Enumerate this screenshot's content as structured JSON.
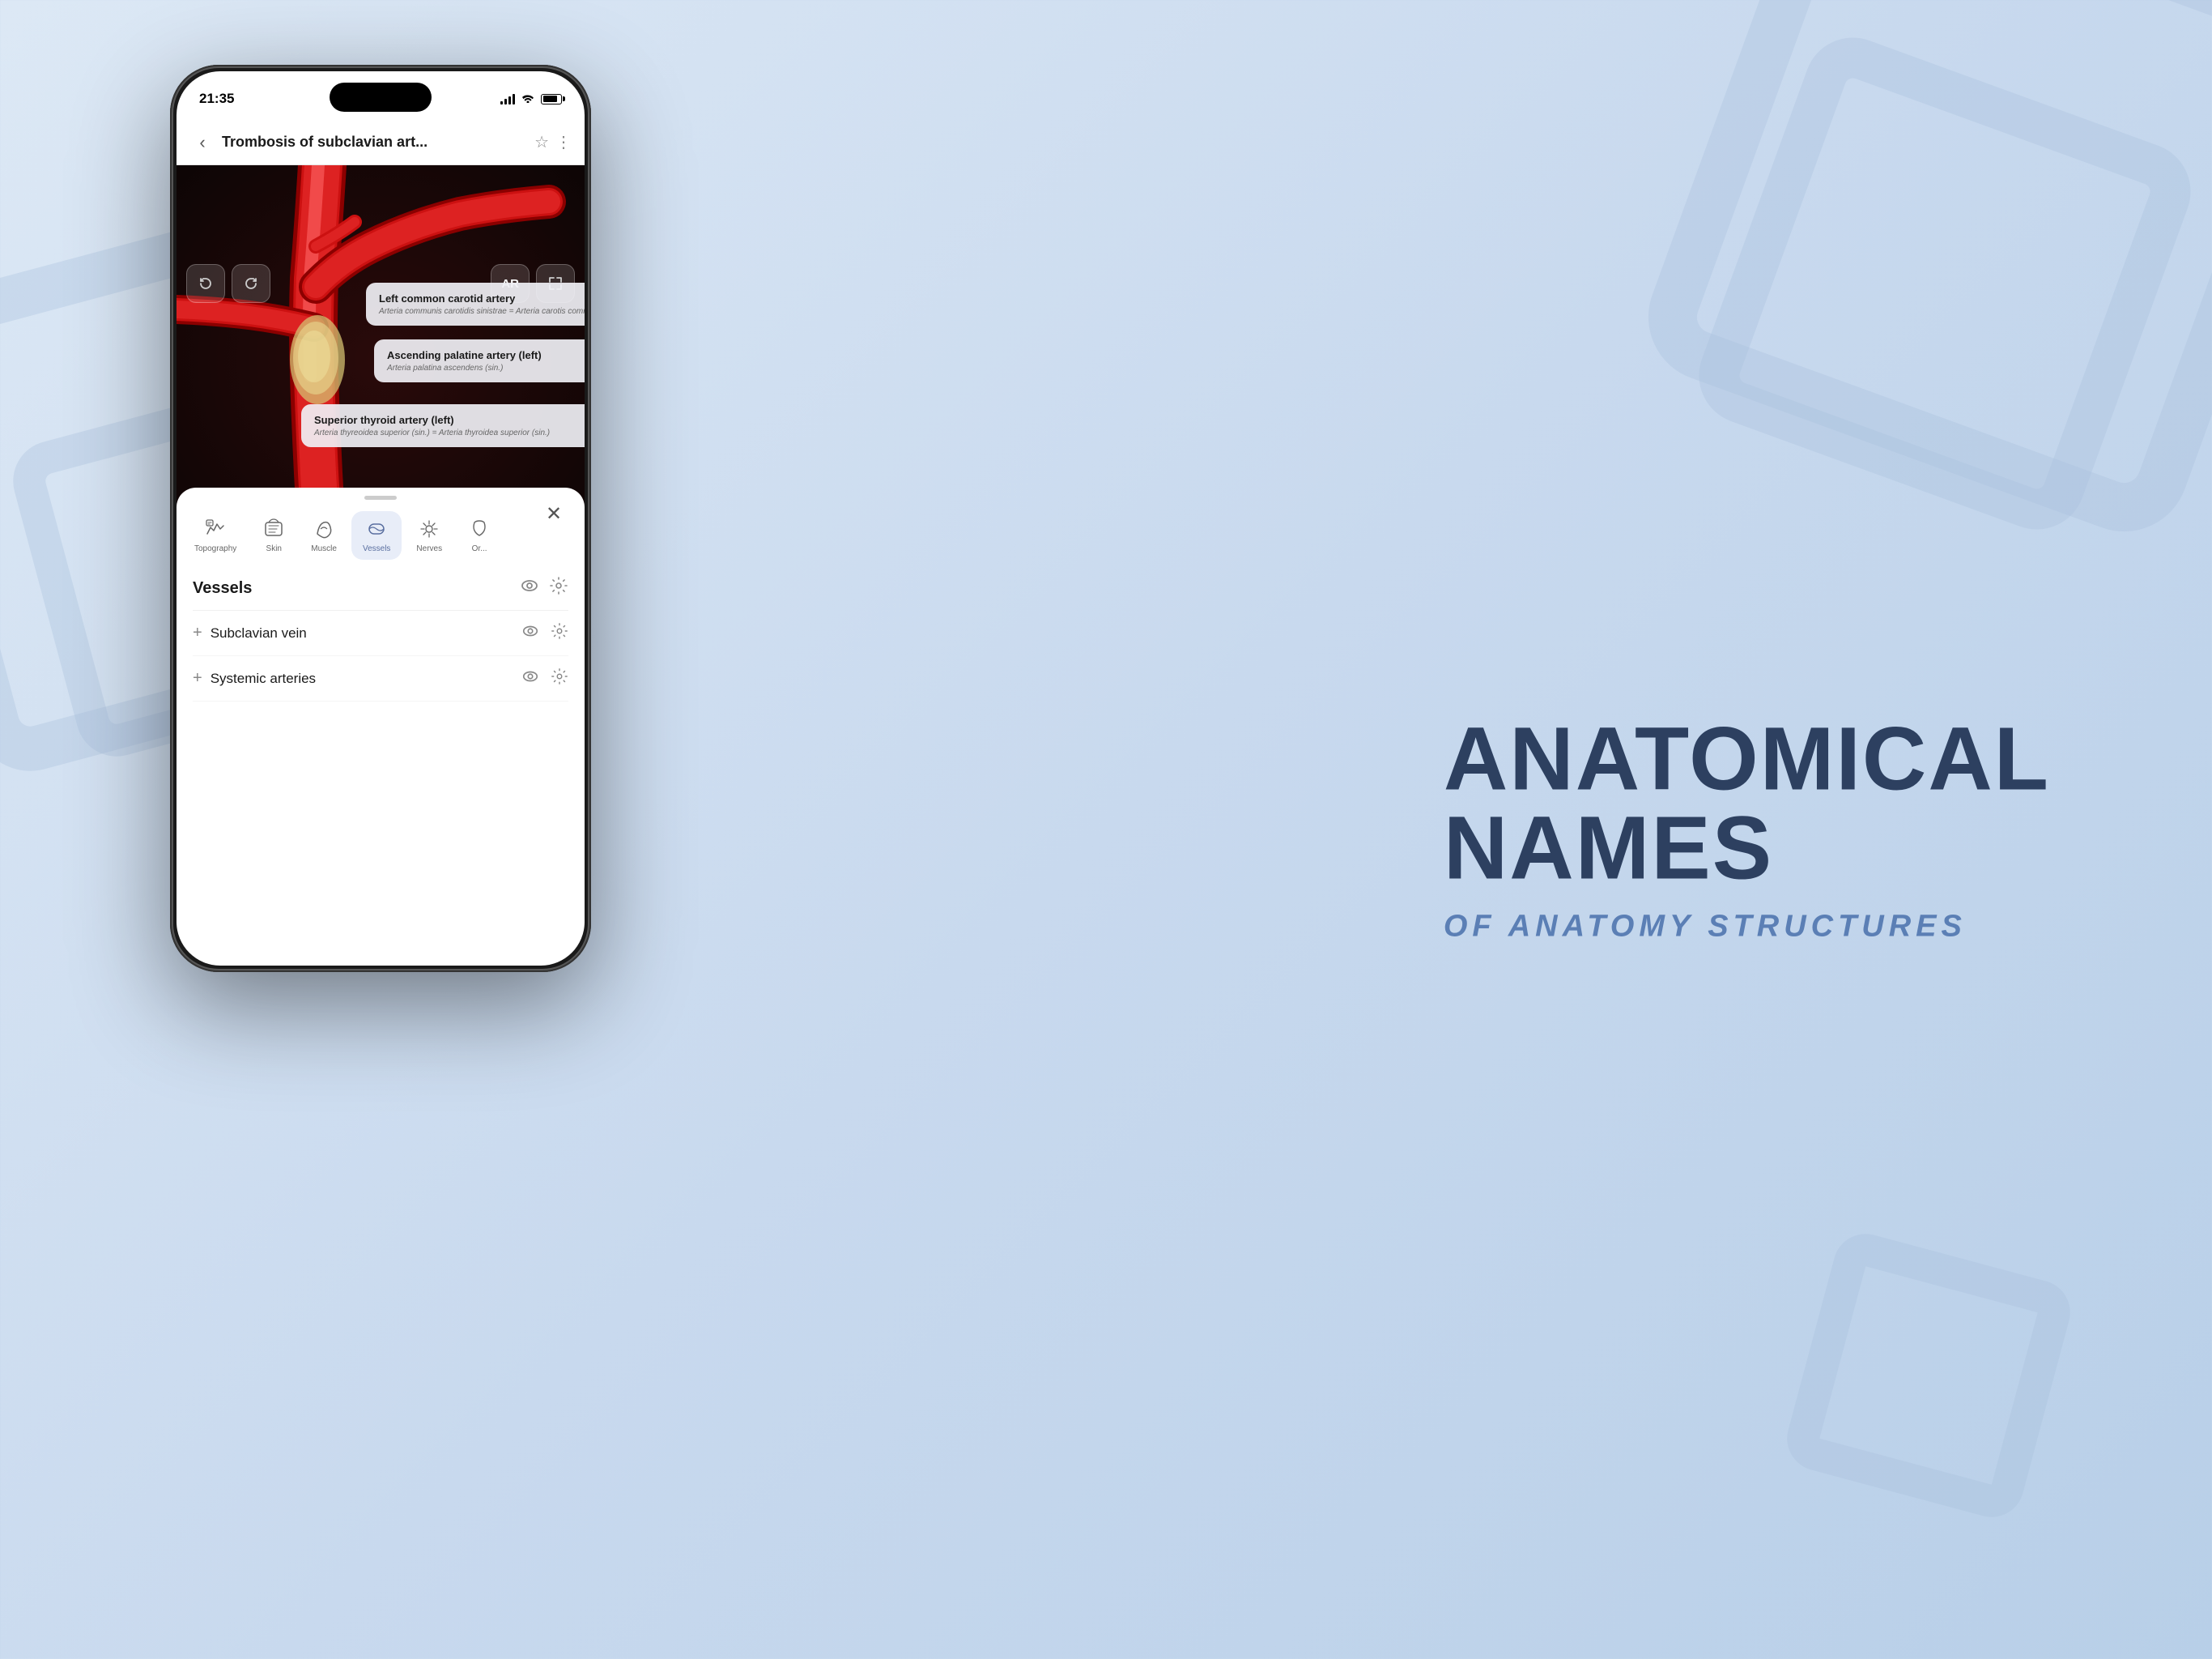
{
  "background": {
    "gradient_start": "#dce8f5",
    "gradient_end": "#b8cfe8"
  },
  "phone": {
    "status_bar": {
      "time": "21:35"
    },
    "nav": {
      "back_icon": "‹",
      "title": "Trombosis of subclavian art...",
      "star_icon": "☆",
      "more_icon": "⋮"
    },
    "toolbar": {
      "undo_icon": "↺",
      "redo_icon": "↻",
      "ar_label": "AR",
      "expand_icon": "⤢"
    },
    "labels": [
      {
        "id": "label-1",
        "title": "Left common carotid artery",
        "subtitle": "Arteria communis carotidis sinistrae = Arteria carotis communis sinistrae"
      },
      {
        "id": "label-2",
        "title": "Ascending palatine artery (left)",
        "subtitle": "Arteria palatina ascendens (sin.)"
      },
      {
        "id": "label-3",
        "title": "Superior thyroid artery (left)",
        "subtitle": "Arteria thyreoidea superior (sin.) = Arteria thyroidea superior (sin.)"
      }
    ],
    "bottom_sheet": {
      "close_icon": "✕",
      "tabs": [
        {
          "id": "topography",
          "label": "Topography",
          "active": false
        },
        {
          "id": "skin",
          "label": "Skin",
          "active": false
        },
        {
          "id": "muscle",
          "label": "Muscle",
          "active": false
        },
        {
          "id": "vessels",
          "label": "Vessels",
          "active": true
        },
        {
          "id": "nerves",
          "label": "Nerves",
          "active": false
        },
        {
          "id": "organs",
          "label": "Or...",
          "active": false
        }
      ],
      "section_title": "Vessels",
      "items": [
        {
          "label": "Subclavian vein"
        },
        {
          "label": "Systemic arteries"
        }
      ]
    }
  },
  "right_text": {
    "main_line1": "ANATOMICAL",
    "main_line2": "NAMES",
    "sub_label": "OF ANATOMY STRUCTURES"
  }
}
